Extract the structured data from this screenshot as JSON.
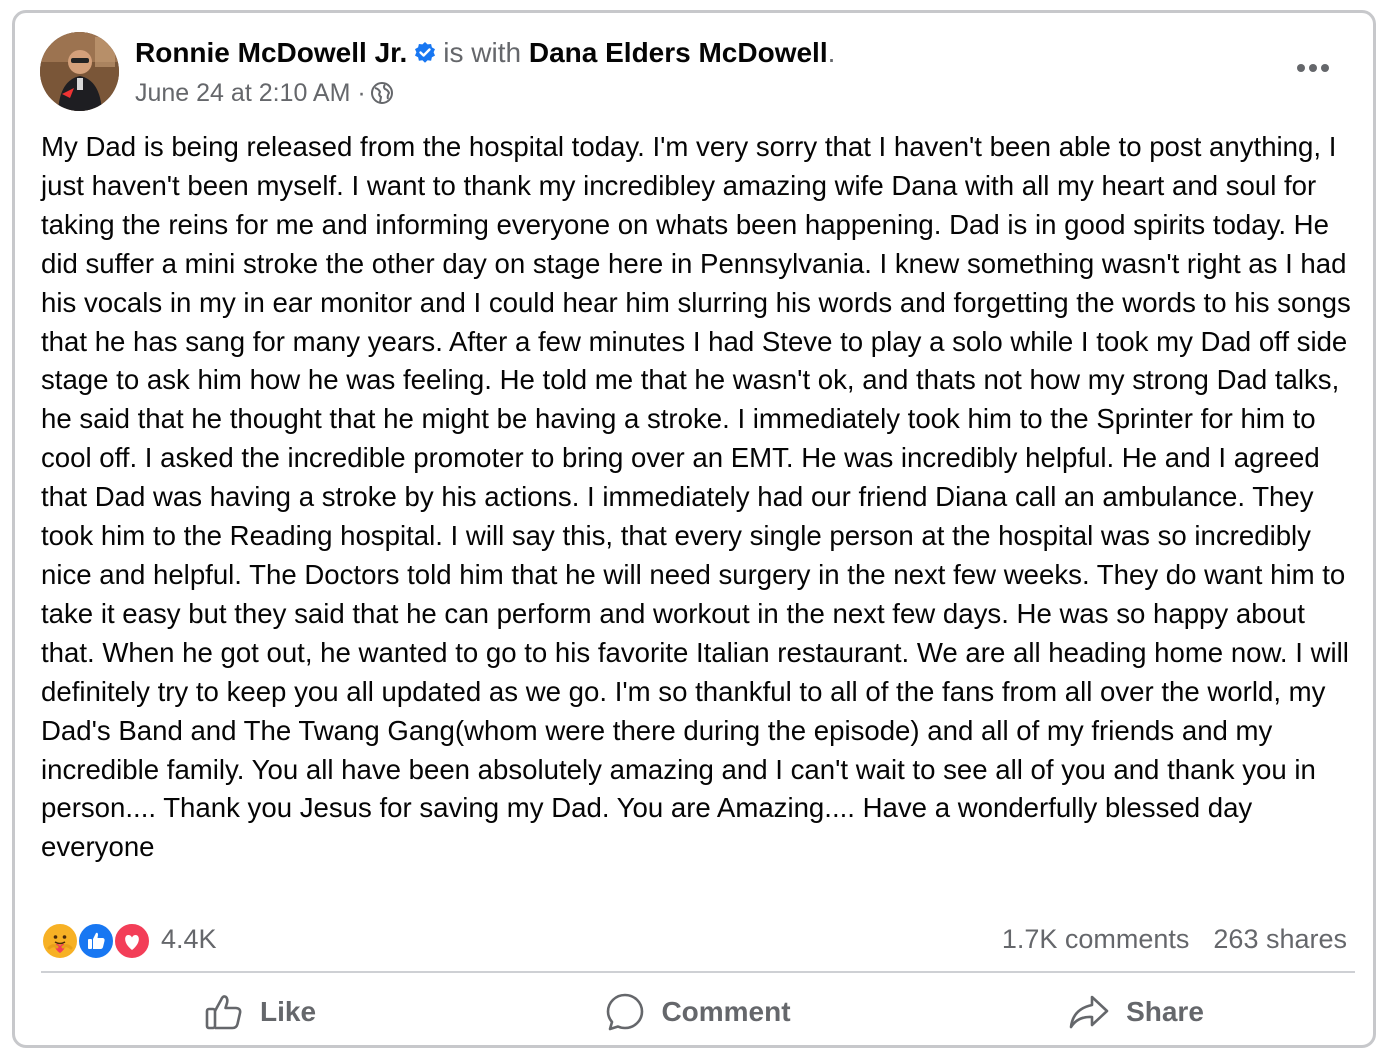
{
  "post": {
    "author": "Ronnie McDowell Jr.",
    "with_text": "is with",
    "tagged": "Dana Elders McDowell",
    "period": ".",
    "timestamp": "June 24 at 2:10 AM",
    "separator": "·",
    "audience_icon": "globe-icon",
    "body": "My Dad is being released from the hospital today. I'm very sorry that I haven't been able to post anything, I just haven't been myself. I want to thank my incredibley amazing wife Dana with all my heart and soul for taking the reins for me and informing everyone on whats been happening. Dad is in good spirits today. He did suffer a mini stroke the other day on stage here in Pennsylvania. I knew something wasn't right as I had his vocals in my in ear monitor and I could hear him slurring his words and forgetting the words to his songs that he has sang for many years. After a few minutes I had Steve to play a solo while I took my Dad off side stage to ask him how he was feeling. He told me that he wasn't ok, and thats not how my strong Dad talks, he said that he thought that he might be having a stroke. I immediately took him to the Sprinter for him to cool off. I asked the incredible promoter to bring over an EMT. He was incredibly helpful. He and I agreed that Dad was having a stroke by his actions. I immediately had our friend Diana call an ambulance. They took him to the Reading hospital. I will say this, that every single person at the hospital was so incredibly nice and helpful. The Doctors told him that he will need surgery in the next few weeks. They do want him to take it easy but they said that he can perform and workout in the next few days. He was so happy about that. When he got out, he wanted to go to his favorite Italian restaurant. We are all heading home now. I will definitely try to keep you all updated as we go. I'm so thankful to all of the fans from all over the world, my Dad's Band and The Twang Gang(whom were there during the episode) and all of my friends and my incredible family. You all have been absolutely amazing and I can't wait to see all of you and thank you in person.... Thank you Jesus for saving my Dad. You are Amazing.... Have a wonderfully blessed day everyone"
  },
  "engagement": {
    "reaction_icons": [
      "care-icon",
      "like-icon",
      "love-icon"
    ],
    "reactions_count": "4.4K",
    "comments": "1.7K comments",
    "shares": "263 shares"
  },
  "actions": {
    "like": "Like",
    "comment": "Comment",
    "share": "Share"
  },
  "colors": {
    "like_blue": "#1877f2",
    "love_red": "#f33e58",
    "care_yellow": "#f7b125",
    "secondary_text": "#65676b",
    "border": "#c7c8cb"
  }
}
